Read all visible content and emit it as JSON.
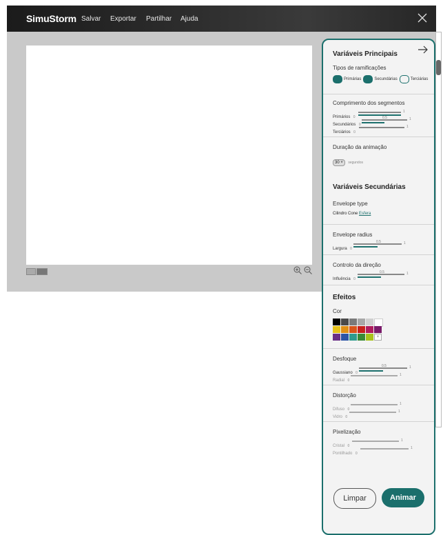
{
  "app": {
    "brand": "SimuStorm",
    "menu": [
      "Salvar",
      "Exportar",
      "Partilhar",
      "Ajuda"
    ]
  },
  "panel": {
    "title": "Variáveis Principais",
    "branch_types": {
      "label": "Tipos de ramificações",
      "options": [
        {
          "label": "Primárias",
          "selected": true
        },
        {
          "label": "Secundárias",
          "selected": true
        },
        {
          "label": "Terciárias",
          "selected": false
        }
      ]
    },
    "segments": {
      "label": "Comprimento dos segmentos",
      "sliders": [
        {
          "label": "Primários",
          "min": "0",
          "max": "1",
          "value": 1,
          "value_label": ""
        },
        {
          "label": "Secundários",
          "min": "0",
          "max": "1",
          "value": 0.5,
          "value_label": "0.5"
        },
        {
          "label": "Terciários",
          "min": "0",
          "max": "1",
          "value": 0,
          "value_label": ""
        }
      ]
    },
    "duration": {
      "label": "Duração da animação",
      "value": "30",
      "unit": "segundos"
    },
    "secondary_title": "Variáveis Secundárias",
    "envelope_type": {
      "label": "Envelope type",
      "options": [
        "Cilindro",
        "Cone",
        "Esfera"
      ],
      "selected": "Esfera"
    },
    "envelope_radius": {
      "label": "Envelope radius",
      "slider": {
        "label": "Largura",
        "min": "0",
        "max": "1",
        "value": 0.5,
        "value_label": "0.5"
      }
    },
    "direction": {
      "label": "Controlo da direção",
      "slider": {
        "label": "Influência",
        "min": "0",
        "max": "1",
        "value": 0.5,
        "value_label": "0.5"
      }
    },
    "effects_title": "Efeitos",
    "color": {
      "label": "Cor",
      "add_label": "+",
      "swatches": [
        [
          "#000000",
          "#4a4a4a",
          "#7a7a7a",
          "#a8a8a8",
          "#d0d0d0",
          "#ffffff"
        ],
        [
          "#e6c21a",
          "#e09016",
          "#d9541a",
          "#c7211c",
          "#b01d5e",
          "#7a1a6a"
        ],
        [
          "#6a2f86",
          "#2e55a6",
          "#2f9b8e",
          "#3a8a35",
          "#a8c21a"
        ]
      ]
    },
    "blur": {
      "label": "Desfoque",
      "sliders": [
        {
          "label": "Gaussiano",
          "min": "0",
          "max": "1",
          "value": 0.5,
          "value_label": "0.5",
          "muted": false
        },
        {
          "label": "Radial",
          "min": "0",
          "max": "1",
          "value": 0,
          "value_label": "",
          "muted": true
        }
      ]
    },
    "distortion": {
      "label": "Distorção",
      "sliders": [
        {
          "label": "Difuso",
          "min": "0",
          "max": "1",
          "value": 0,
          "value_label": "",
          "muted": true
        },
        {
          "label": "Vidro",
          "min": "0",
          "max": "1",
          "value": 0,
          "value_label": "",
          "muted": true
        }
      ]
    },
    "pixelation": {
      "label": "Pixelização",
      "sliders": [
        {
          "label": "Cristal",
          "min": "0",
          "max": "1",
          "value": 0,
          "value_label": "",
          "muted": true
        },
        {
          "label": "Pontilhado",
          "min": "0",
          "max": "1",
          "value": 0,
          "value_label": "",
          "muted": true
        }
      ]
    },
    "buttons": {
      "clear": "Limpar",
      "animate": "Animar"
    }
  },
  "colors": {
    "accent": "#1b6f6c",
    "topbar": "#262626",
    "workspace": "#c9c9c9"
  }
}
